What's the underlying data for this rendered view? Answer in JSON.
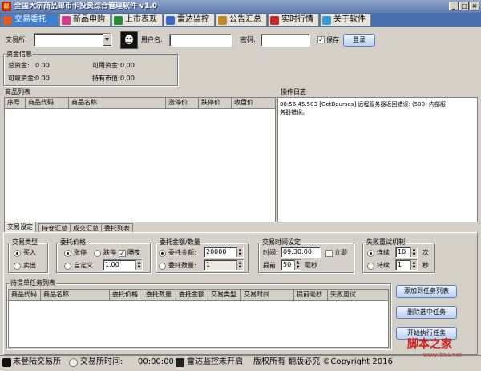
{
  "window": {
    "title": "全国大宗商品邮币卡投资综合管理软件 v1.0",
    "icon_text": "邮"
  },
  "tabs": [
    {
      "label": "交易委托",
      "icon_color": "#e65a1e"
    },
    {
      "label": "新品申购",
      "icon_color": "#d63c8c"
    },
    {
      "label": "上市表现",
      "icon_color": "#2a8a3a"
    },
    {
      "label": "雷达监控",
      "icon_color": "#3a6ac8"
    },
    {
      "label": "公告汇总",
      "icon_color": "#c08a2a"
    },
    {
      "label": "实时行情",
      "icon_color": "#c02a2a"
    },
    {
      "label": "关于软件",
      "icon_color": "#3a9ad8"
    }
  ],
  "login": {
    "exchange_label": "交易所:",
    "exchange_value": "",
    "username_label": "用户名:",
    "username_value": "",
    "password_label": "密码:",
    "password_value": "",
    "save_label": "保存",
    "login_button": "登录"
  },
  "funds": {
    "title": "资金信息",
    "total_label": "总资金:",
    "total_value": "0.00",
    "available_label": "可用资金:",
    "available_value": "0.00",
    "withdrawable_label": "可取资金:",
    "withdrawable_value": "0.00",
    "market_label": "持有市值:",
    "market_value": "0.00"
  },
  "products": {
    "title": "商品列表",
    "columns": [
      "序号",
      "商品代码",
      "商品名称",
      "涨停价",
      "跌停价",
      "收盘价"
    ]
  },
  "log": {
    "title": "操作日志",
    "lines": [
      "08:56:45.503 [GetBourses] 远程服务器返回错误: (500) 内部服",
      "务器错误。"
    ]
  },
  "subtabs": [
    "交易设定",
    "持仓汇总",
    "成交汇总",
    "委托列表"
  ],
  "trade_type": {
    "title": "交易类型",
    "buy": "买入",
    "sell": "卖出"
  },
  "price": {
    "title": "委托价格",
    "limit_up": "涨停",
    "limit_down": "跌停",
    "overnight": "隔夜",
    "custom": "自定义",
    "custom_value": "1.00"
  },
  "amount": {
    "title": "委托金额/数量",
    "amount_label": "委托金额:",
    "amount_value": "20000",
    "qty_label": "委托数量:",
    "qty_value": "1"
  },
  "timing": {
    "title": "交易时间设定",
    "time_label": "时间:",
    "time_value": "09:30:00",
    "immediate": "立即",
    "advance_label": "提前",
    "advance_value": "50",
    "ms_label": "毫秒"
  },
  "retry": {
    "title": "失败重试机制",
    "continuous": "连续",
    "continuous_value": "10",
    "times_label": "次",
    "persist": "持续",
    "persist_value": "1",
    "seconds_label": "秒"
  },
  "pending": {
    "title": "待提单任务列表",
    "columns": [
      "商品代码",
      "商品名称",
      "委托价格",
      "委托数量",
      "委托金额",
      "交易类型",
      "交易时间",
      "提前毫秒",
      "失败重试"
    ]
  },
  "actions": {
    "add": "添加到任务列表",
    "delete": "删除选中任务",
    "start": "开始执行任务"
  },
  "status": {
    "login": "未登陆交易所",
    "time_label": "交易所时间:",
    "time_value": "00:00:00",
    "radar": "雷达监控未开启",
    "copyright": "版权所有 翻版必究 ©Copyright 2016"
  },
  "watermark": {
    "brand": "脚本之家",
    "url": "www.jb51.net"
  }
}
